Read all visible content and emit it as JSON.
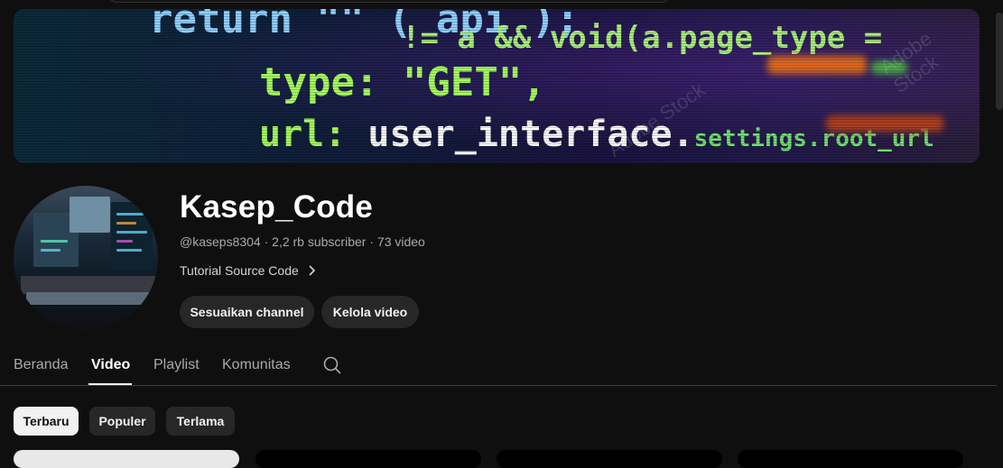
{
  "banner": {
    "code_lines": {
      "l1": "return \"\" (  api );",
      "l2": "!= a && void(a.page_type =",
      "l3": "type: \"GET\",",
      "l4_key": "url:",
      "l4_value": "user_interface.",
      "l4_rest": "settings.root_url"
    },
    "watermark": "Adobe Stock"
  },
  "channel": {
    "name": "Kasep_Code",
    "handle": "@kaseps8304",
    "subscribers": "2,2 rb subscriber",
    "video_count": "73 video",
    "meta_separator": " · ",
    "description": "Tutorial Source Code"
  },
  "actions": {
    "customize_label": "Sesuaikan channel",
    "manage_label": "Kelola video"
  },
  "tabs": [
    {
      "label": "Beranda",
      "active": false
    },
    {
      "label": "Video",
      "active": true
    },
    {
      "label": "Playlist",
      "active": false
    },
    {
      "label": "Komunitas",
      "active": false
    }
  ],
  "filters": [
    {
      "label": "Terbaru",
      "active": true
    },
    {
      "label": "Populer",
      "active": false
    },
    {
      "label": "Terlama",
      "active": false
    }
  ],
  "icons": {
    "tab_search": "search-icon",
    "description_more": "chevron-right-icon"
  },
  "colors": {
    "background": "#0f0f0f",
    "button_bg": "#272727",
    "active_chip_bg": "#f1f1f1",
    "secondary_text": "#aaaaaa"
  }
}
